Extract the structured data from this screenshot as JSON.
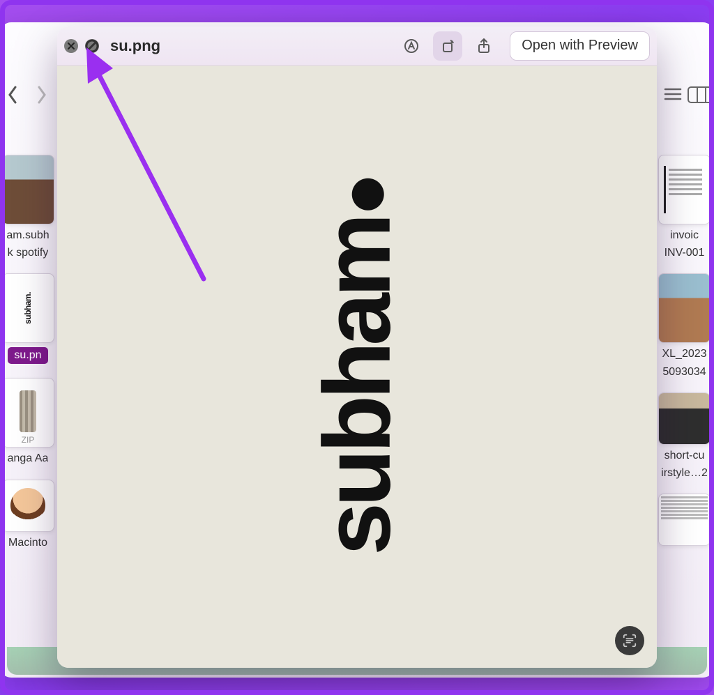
{
  "quicklook": {
    "title": "su.png",
    "open_button": "Open with Preview",
    "image_text": "subham",
    "icons": {
      "markup": "markup-icon",
      "rotate": "rotate-icon",
      "share": "share-icon",
      "live_text": "live-text-icon"
    }
  },
  "finder": {
    "left_items": [
      {
        "label": "am.subh"
      },
      {
        "label": "k spotify"
      },
      {
        "chip": "su.pn"
      },
      {
        "label": "anga Aa"
      },
      {
        "zip_label": "ZIP"
      },
      {
        "label": "Macinto"
      }
    ],
    "right_items": [
      {
        "label": "invoic"
      },
      {
        "label": "INV-001"
      },
      {
        "label": "XL_2023"
      },
      {
        "label": "5093034"
      },
      {
        "label": "short-cu"
      },
      {
        "label": "irstyle…2"
      }
    ]
  }
}
